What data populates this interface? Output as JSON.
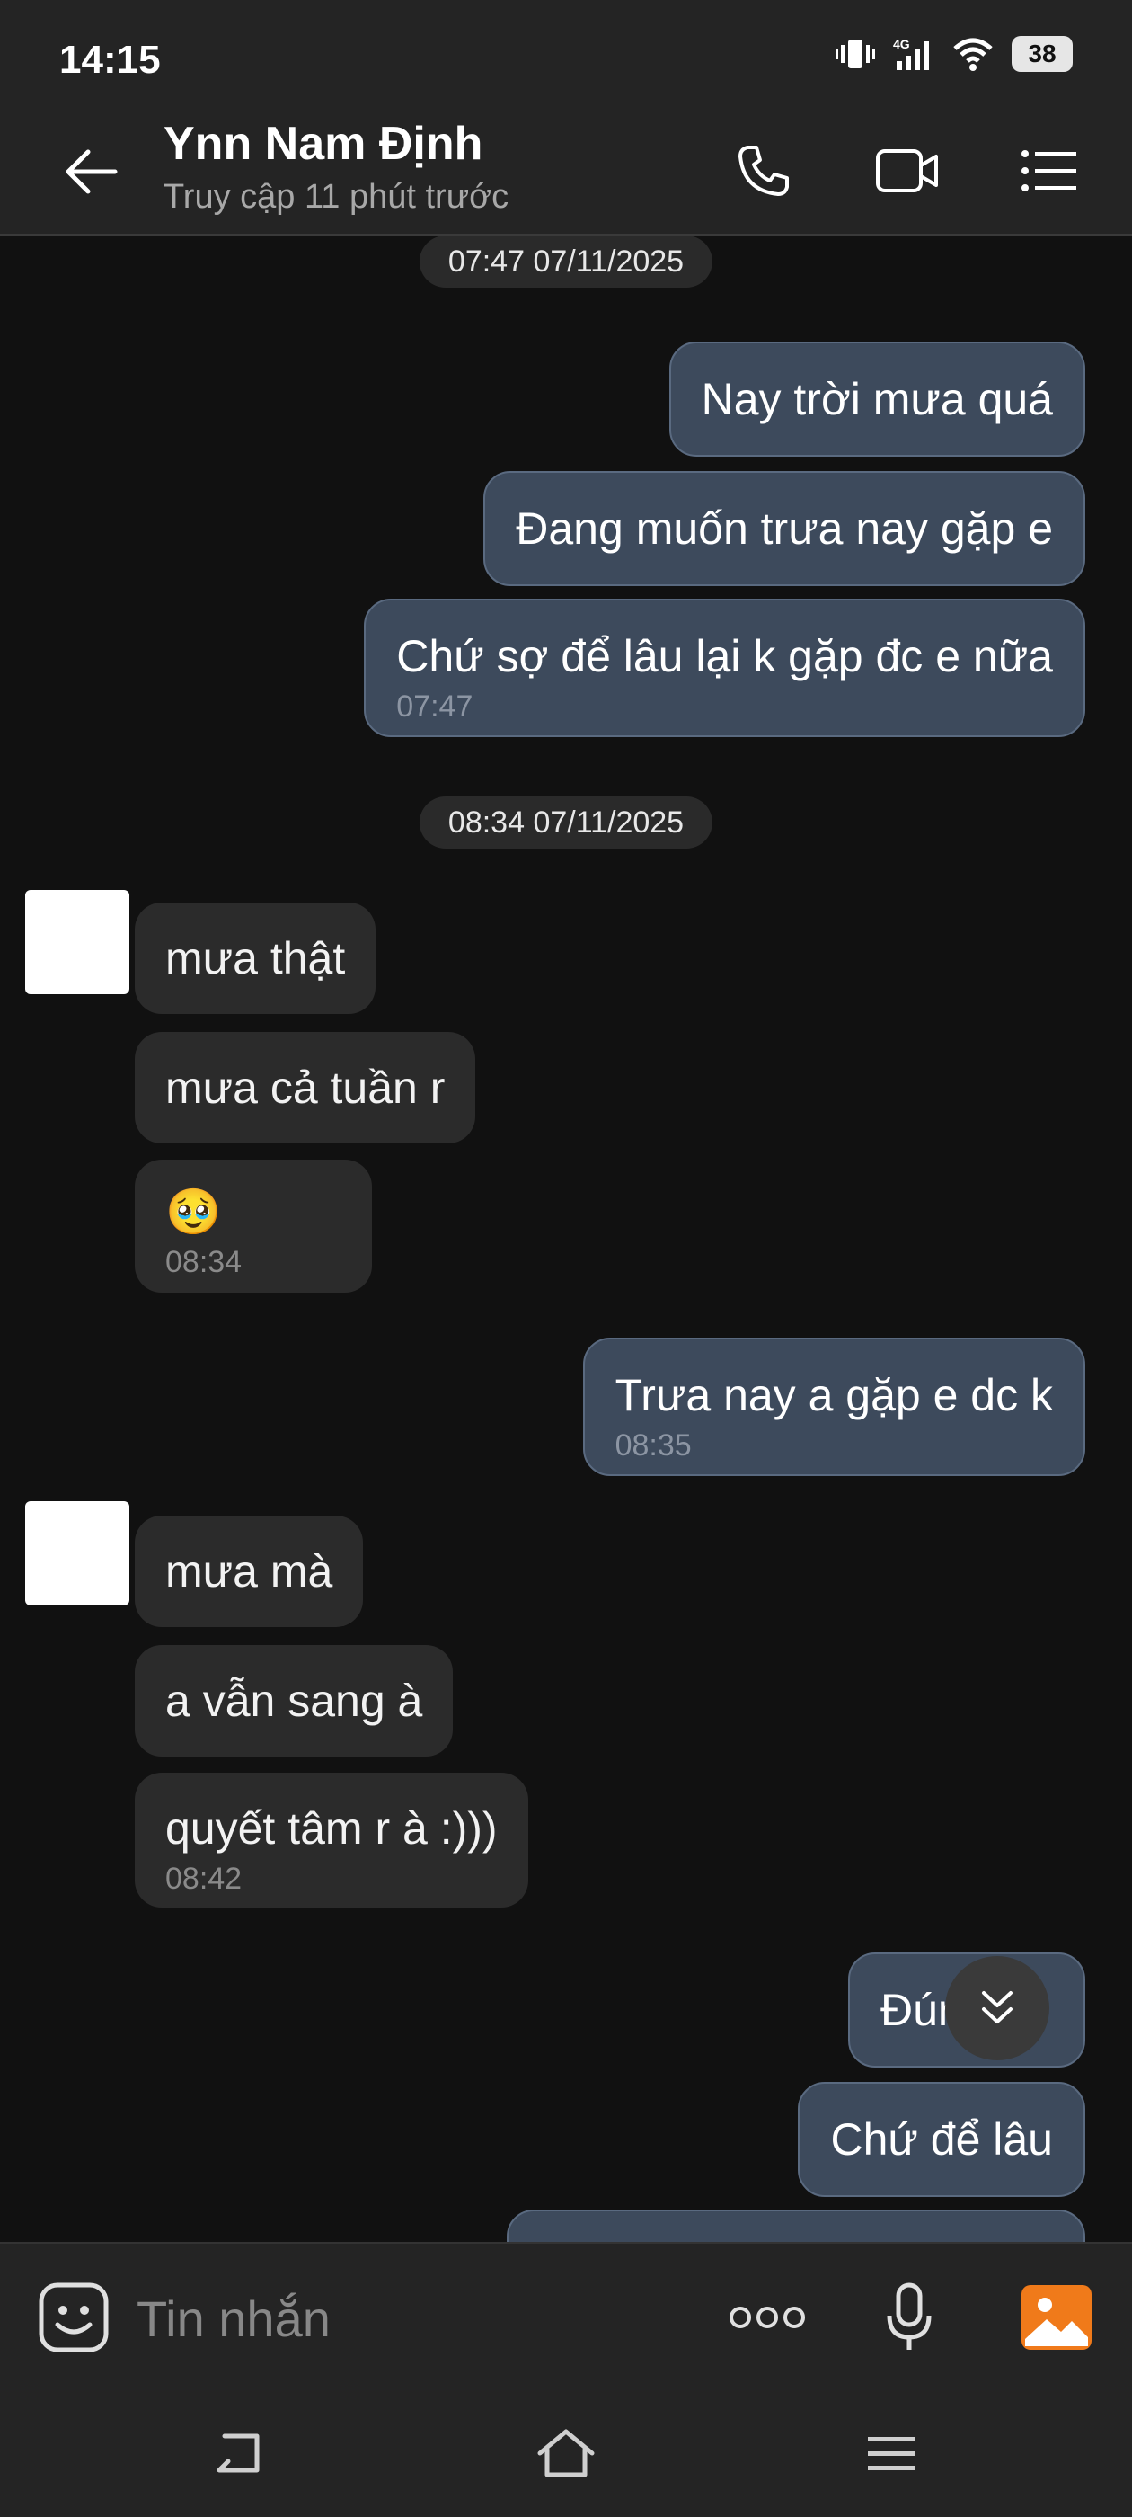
{
  "status_bar": {
    "time": "14:15",
    "battery": "38",
    "network": "4G"
  },
  "header": {
    "name": "Ynn Nam Định",
    "status": "Truy cập 11 phút trước"
  },
  "chat": {
    "timestamps": [
      "07:47 07/11/2025",
      "08:34 07/11/2025"
    ],
    "messages": [
      {
        "dir": "sent",
        "text": "Nay trời mưa quá"
      },
      {
        "dir": "sent",
        "text": "Đang muốn trưa nay gặp e"
      },
      {
        "dir": "sent",
        "text": "Chứ sợ để lâu lại k gặp đc e nữa",
        "time": "07:47"
      },
      {
        "dir": "recv",
        "text": "mưa thật"
      },
      {
        "dir": "recv",
        "text": "mưa cả tuần r"
      },
      {
        "dir": "recv",
        "text": "🥹",
        "time": "08:34"
      },
      {
        "dir": "sent",
        "text": "Trưa nay a gặp e dc k",
        "time": "08:35"
      },
      {
        "dir": "recv",
        "text": "mưa mà"
      },
      {
        "dir": "recv",
        "text": "a vẫn sang à"
      },
      {
        "dir": "recv",
        "text": "quyết tâm r à :)))",
        "time": "08:42"
      },
      {
        "dir": "sent",
        "text": "Đúng"
      },
      {
        "dir": "sent",
        "text": "Chứ để lâu"
      }
    ]
  },
  "input": {
    "placeholder": "Tin nhắn"
  },
  "icons": {
    "back": "arrow-left-icon",
    "call": "phone-icon",
    "video": "video-icon",
    "menu": "list-icon",
    "emoji": "sticker-icon",
    "more": "more-dots-icon",
    "mic": "mic-icon",
    "gallery": "image-icon",
    "scroll": "chevrons-down-icon"
  },
  "colors": {
    "sent_bubble": "#3d4a5c",
    "recv_bubble": "#2b2b2b",
    "gallery_accent": "#f07a1a"
  }
}
